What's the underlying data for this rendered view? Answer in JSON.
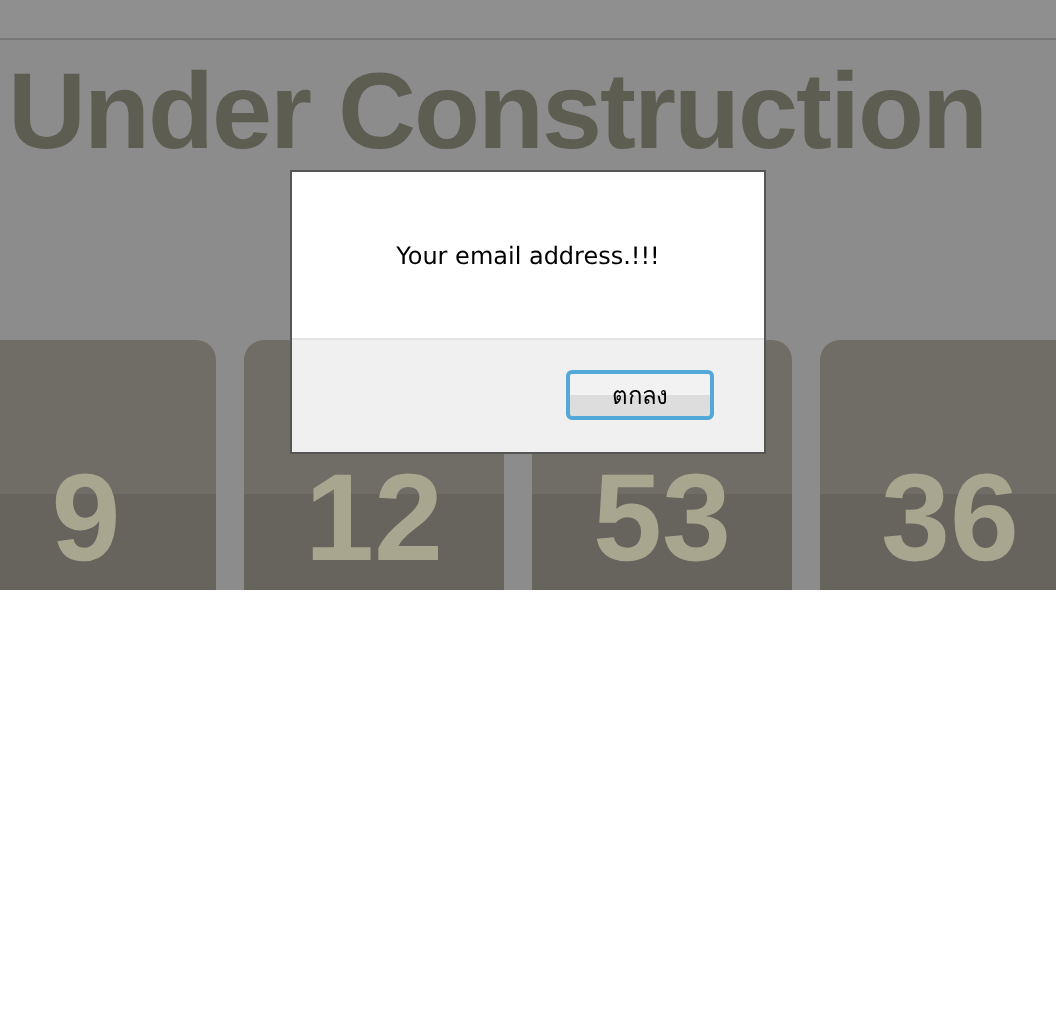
{
  "heading": "Under Construction",
  "countdown": [
    "9",
    "12",
    "53",
    "36"
  ],
  "dialog": {
    "message": "Your email address.!!!",
    "buttons": [
      {
        "label": "ตกลง",
        "selected": true
      }
    ]
  }
}
